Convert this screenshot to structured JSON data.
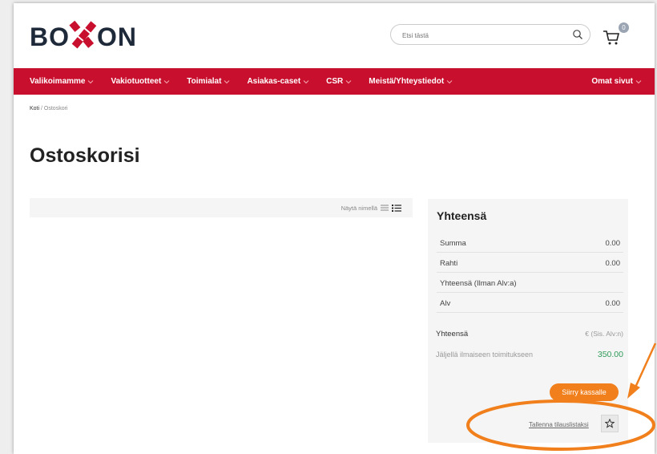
{
  "header": {
    "logo_prefix": "BO",
    "logo_suffix": "ON",
    "search_placeholder": "Etsi tästä",
    "cart_count": "0"
  },
  "nav": {
    "items": [
      {
        "label": "Valikoimamme"
      },
      {
        "label": "Vakiotuotteet"
      },
      {
        "label": "Toimialat"
      },
      {
        "label": "Asiakas-caset"
      },
      {
        "label": "CSR"
      },
      {
        "label": "Meistä/Yhteystiedot"
      }
    ],
    "right_item": "Omat sivut"
  },
  "breadcrumb": {
    "home": "Koti",
    "separator": "/",
    "current": "Ostoskori"
  },
  "page_title": "Ostoskorisi",
  "toolbar": {
    "view_label": "Näytä nimellä"
  },
  "summary": {
    "title": "Yhteensä",
    "rows": [
      {
        "label": "Summa",
        "value": "0.00"
      },
      {
        "label": "Rahti",
        "value": "0.00"
      },
      {
        "label": "Yhteensä (Ilman Alv:a)",
        "value": ""
      },
      {
        "label": "Alv",
        "value": "0.00"
      }
    ],
    "total_label": "Yhteensä",
    "total_value": "€ (Sis. Alv:n)",
    "free_shipping_label": "Jäljellä ilmaiseen toimitukseen",
    "free_shipping_value": "350.00",
    "checkout_label": "Siirry kassalle",
    "save_list_label": "Tallenna tilauslistaksi"
  },
  "colors": {
    "brand_red": "#c8102e",
    "checkout_orange": "#f07f1c",
    "annotation_orange": "#f07f1c",
    "free_shipping_green": "#2e9a58"
  }
}
